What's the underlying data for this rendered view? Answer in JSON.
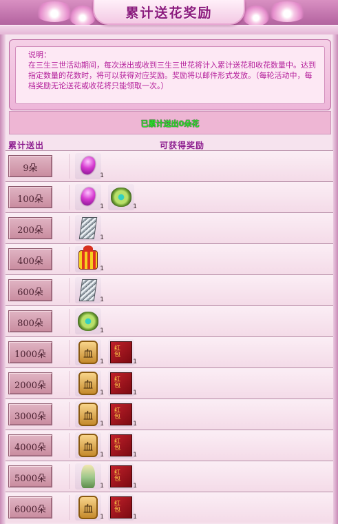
{
  "header": {
    "title": "累计送花奖励"
  },
  "info": {
    "title": "说明：",
    "text": "在三生三世活动期间，每次送出或收到三生三世花将计入累计送花和收花数量中。达到指定数量的花数时，将可以获得对应奖励。奖励将以邮件形式发放。（每轮活动中，每档奖励无论送花或收花将只能领取一次。）"
  },
  "sent_status": "已累计送出0朵花",
  "columns": {
    "sent": "累计送出",
    "rewards": "可获得奖励"
  },
  "rows": [
    {
      "tier": "9朵",
      "items": [
        {
          "icon": "purple-gem-icon",
          "qty": "1"
        }
      ]
    },
    {
      "tier": "100朵",
      "items": [
        {
          "icon": "purple-gem-icon",
          "qty": "1"
        },
        {
          "icon": "jade-ring-icon",
          "qty": "1"
        }
      ]
    },
    {
      "tier": "200朵",
      "items": [
        {
          "icon": "silver-card-icon",
          "qty": "1"
        }
      ]
    },
    {
      "tier": "400朵",
      "items": [
        {
          "icon": "gift-box-icon",
          "qty": "1"
        }
      ]
    },
    {
      "tier": "600朵",
      "items": [
        {
          "icon": "silver-card-icon",
          "qty": "1"
        }
      ]
    },
    {
      "tier": "800朵",
      "items": [
        {
          "icon": "jade-ring-icon",
          "qty": "1"
        }
      ]
    },
    {
      "tier": "1000朵",
      "items": [
        {
          "icon": "gold-token-icon",
          "qty": "1"
        },
        {
          "icon": "red-envelope-icon",
          "qty": "1"
        }
      ]
    },
    {
      "tier": "2000朵",
      "items": [
        {
          "icon": "gold-token-icon",
          "qty": "1"
        },
        {
          "icon": "red-envelope-icon",
          "qty": "1"
        }
      ]
    },
    {
      "tier": "3000朵",
      "items": [
        {
          "icon": "gold-token-icon",
          "qty": "1"
        },
        {
          "icon": "red-envelope-icon",
          "qty": "1"
        }
      ]
    },
    {
      "tier": "4000朵",
      "items": [
        {
          "icon": "gold-token-icon",
          "qty": "1"
        },
        {
          "icon": "red-envelope-icon",
          "qty": "1"
        }
      ]
    },
    {
      "tier": "5000朵",
      "items": [
        {
          "icon": "fairy-figure-icon",
          "qty": "1"
        },
        {
          "icon": "red-envelope-icon",
          "qty": "1"
        }
      ]
    },
    {
      "tier": "6000朵",
      "items": [
        {
          "icon": "gold-token-icon",
          "qty": "1"
        },
        {
          "icon": "red-envelope-icon",
          "qty": "1"
        }
      ]
    }
  ]
}
